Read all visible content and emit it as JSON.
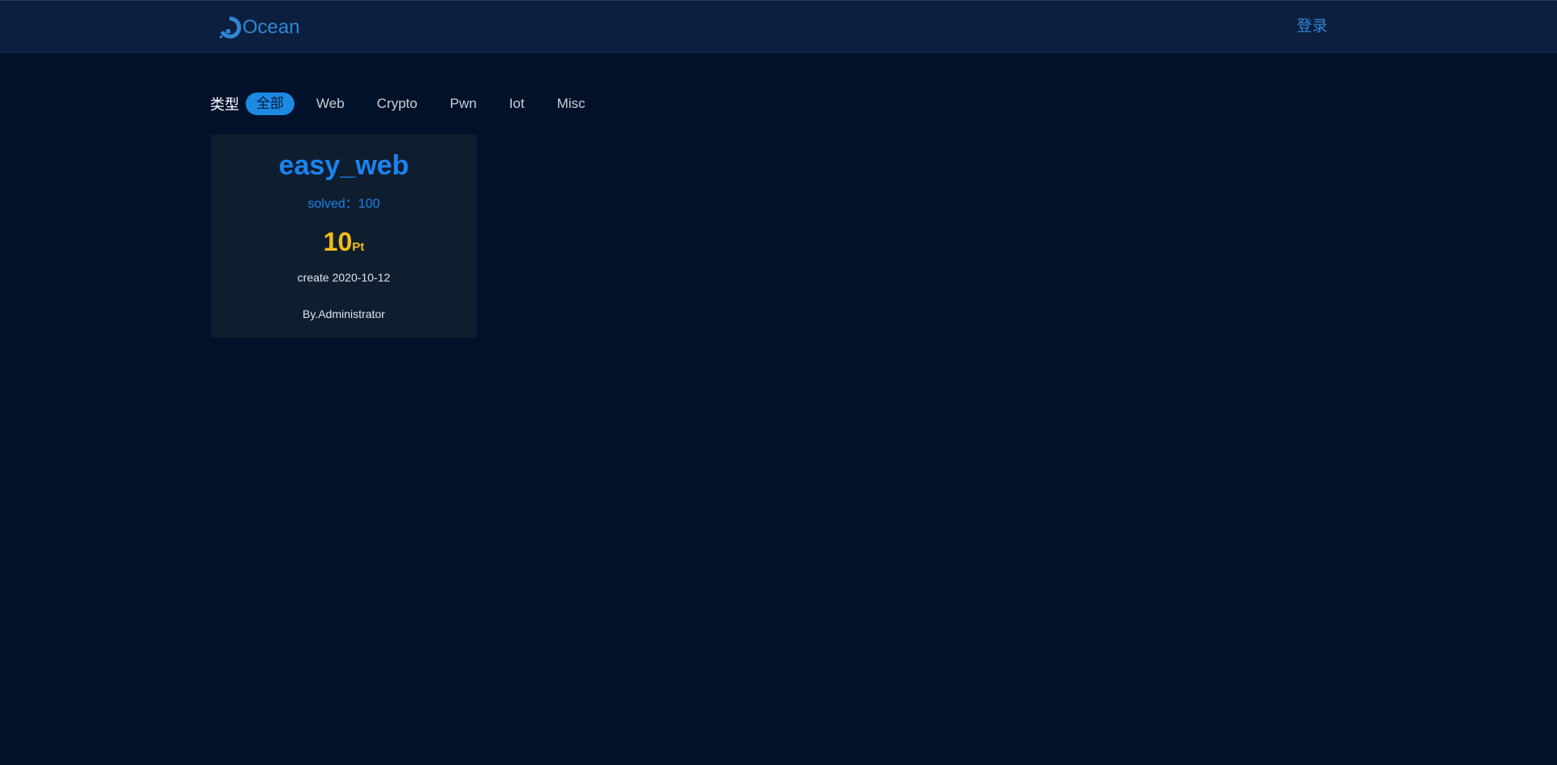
{
  "header": {
    "brand_name": "Ocean",
    "brand_icon": "ocean-logo-icon",
    "login_label": "登录"
  },
  "filters": {
    "label": "类型",
    "items": [
      "全部",
      "Web",
      "Crypto",
      "Pwn",
      "Iot",
      "Misc"
    ],
    "active": "全部"
  },
  "challenges": [
    {
      "title": "easy_web",
      "solved": "solved：100",
      "points": "10",
      "points_unit": "Pt",
      "created": "create 2020-10-12",
      "author": "By.Administrator"
    }
  ],
  "colors": {
    "background": "#02112a",
    "navbar": "#0c1f3e",
    "accent": "#2f86d6",
    "active_pill": "#1c8ae3",
    "title_blue": "#1a84f0",
    "points_gold": "#f3bb16",
    "card_bg": "#0f1e2f"
  }
}
